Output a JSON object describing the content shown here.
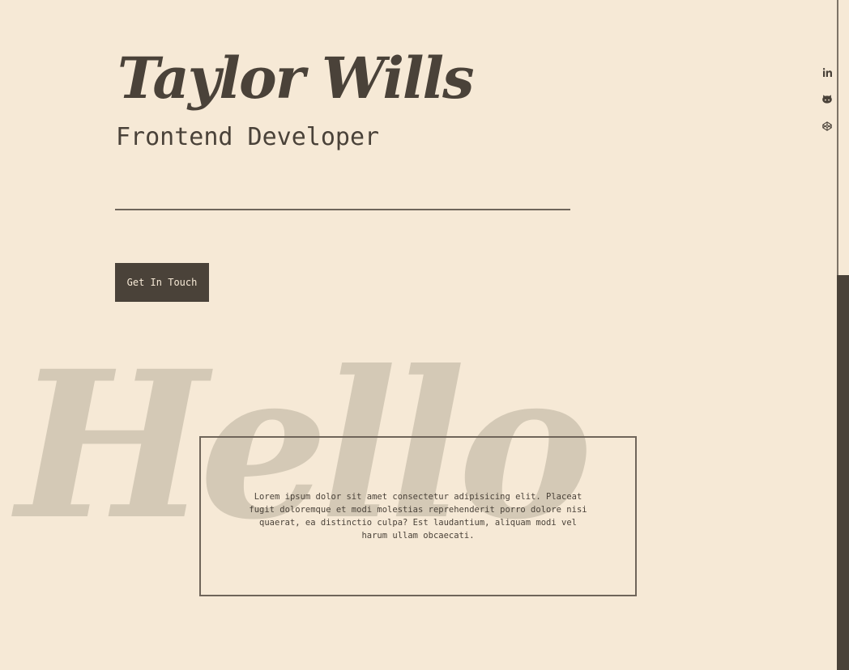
{
  "hero": {
    "name": "Taylor Wills",
    "role": "Frontend Developer",
    "cta_label": "Get In Touch"
  },
  "background_word": "Hello",
  "about": {
    "text": "Lorem ipsum dolor sit amet consectetur adipisicing elit. Placeat fugit doloremque et modi molestias reprehenderit porro dolore nisi quaerat, ea distinctio culpa? Est laudantium, aliquam modi vel harum ullam obcaecati."
  },
  "social": {
    "icons": [
      "linkedin-icon",
      "github-icon",
      "codepen-icon"
    ]
  },
  "scroll": {
    "position": 0.41
  },
  "colors": {
    "background": "#f6e9d6",
    "primary": "#4a4239",
    "faded_text": "#d4c9b6",
    "line": "#6f655a"
  }
}
